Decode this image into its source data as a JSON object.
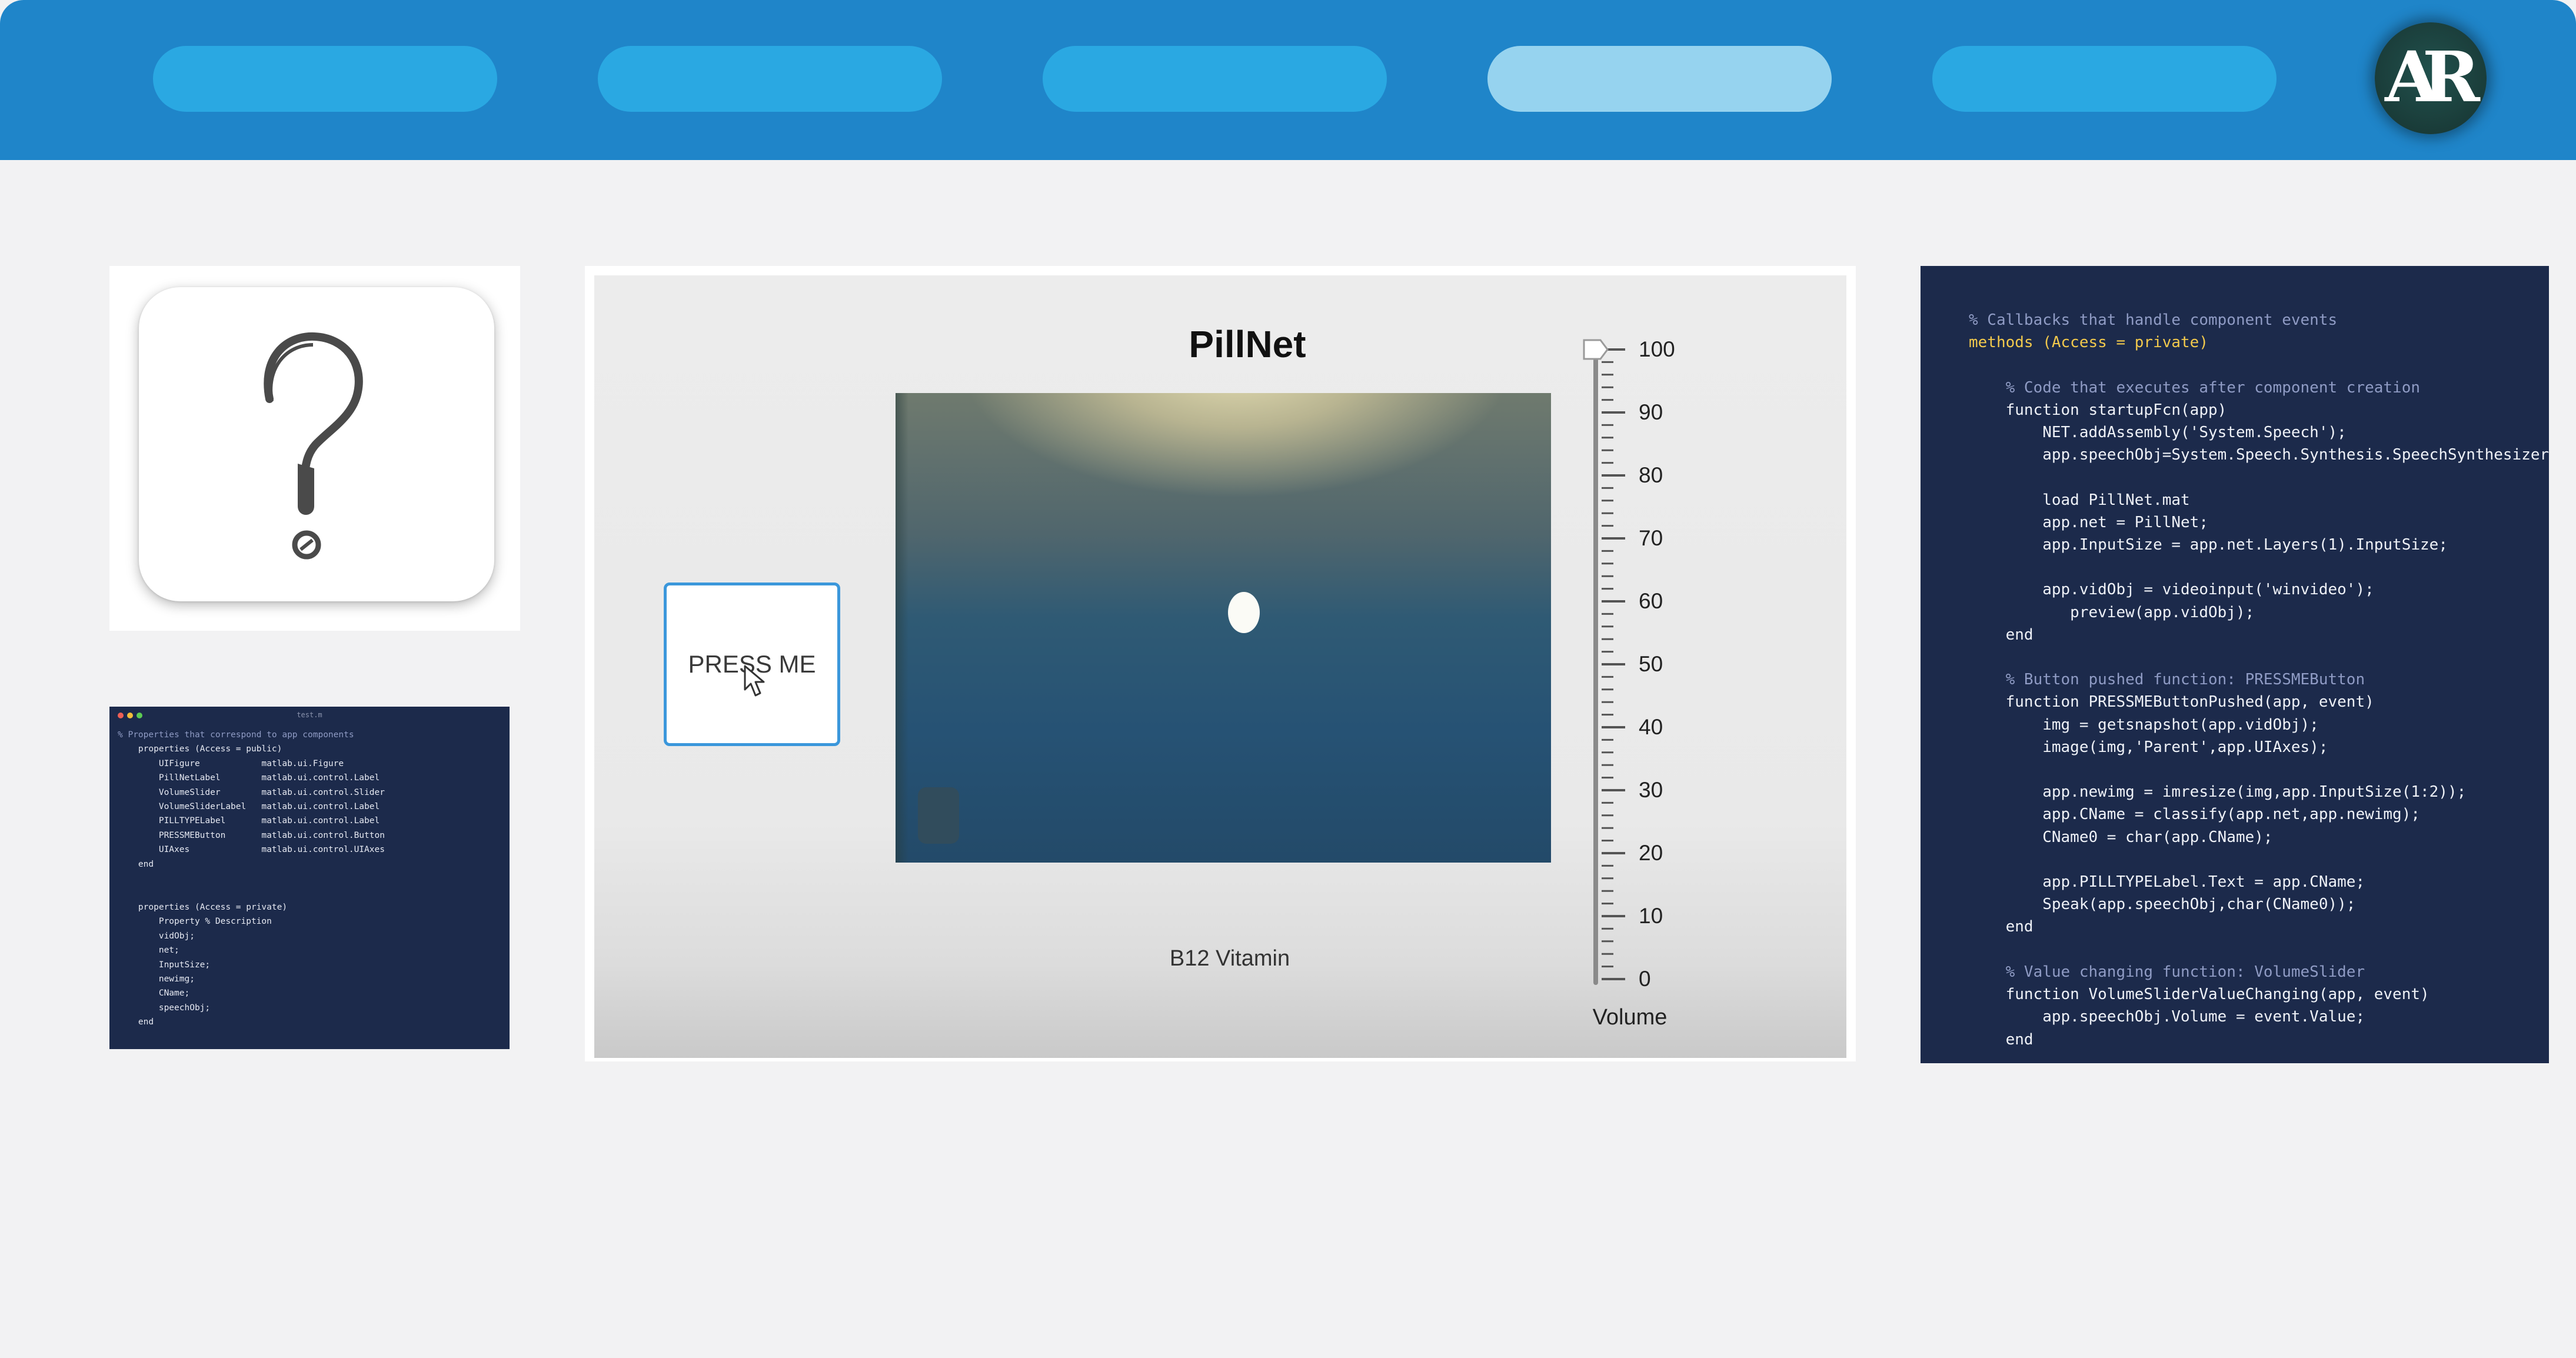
{
  "nav": {
    "items": [
      {
        "label": "",
        "active": false
      },
      {
        "label": "",
        "active": false
      },
      {
        "label": "",
        "active": false
      },
      {
        "label": "",
        "active": true
      },
      {
        "label": "",
        "active": false
      }
    ],
    "logo_text": "AR",
    "colors": {
      "bar": "#1f85c9",
      "pill": "#2aa8e2",
      "pill_active": "#96d3ef"
    }
  },
  "help_card": {
    "icon": "question-mark-icon"
  },
  "small_code": {
    "filename": "test.m",
    "lines": [
      "% Properties that correspond to app components",
      "    properties (Access = public)",
      "        UIFigure            matlab.ui.Figure",
      "        PillNetLabel        matlab.ui.control.Label",
      "        VolumeSlider        matlab.ui.control.Slider",
      "        VolumeSliderLabel   matlab.ui.control.Label",
      "        PILLTYPELabel       matlab.ui.control.Label",
      "        PRESSMEButton       matlab.ui.control.Button",
      "        UIAxes              matlab.ui.control.UIAxes",
      "    end",
      "",
      "",
      "    properties (Access = private)",
      "        Property % Description",
      "        vidObj;",
      "        net;",
      "        InputSize;",
      "        newimg;",
      "        CName;",
      "        speechObj;",
      "    end"
    ]
  },
  "app": {
    "title": "PillNet",
    "button_label": "PRESS ME",
    "result_label": "B12 Vitamin",
    "volume": {
      "label": "Volume",
      "value": 100,
      "range": [
        0,
        100
      ],
      "ticks": [
        "100",
        "90",
        "80",
        "70",
        "60",
        "50",
        "40",
        "30",
        "20",
        "10",
        "0"
      ]
    }
  },
  "big_code": {
    "lines": [
      "% Callbacks that handle component events",
      "methods (Access = private)",
      "",
      "    % Code that executes after component creation",
      "    function startupFcn(app)",
      "        NET.addAssembly('System.Speech');",
      "        app.speechObj=System.Speech.Synthesis.SpeechSynthesizer;",
      "",
      "        load PillNet.mat",
      "        app.net = PillNet;",
      "        app.InputSize = app.net.Layers(1).InputSize;",
      "",
      "        app.vidObj = videoinput('winvideo');",
      "           preview(app.vidObj);",
      "    end",
      "",
      "    % Button pushed function: PRESSMEButton",
      "    function PRESSMEButtonPushed(app, event)",
      "        img = getsnapshot(app.vidObj);",
      "        image(img,'Parent',app.UIAxes);",
      "",
      "        app.newimg = imresize(img,app.InputSize(1:2));",
      "        app.CName = classify(app.net,app.newimg);",
      "        CName0 = char(app.CName);",
      "",
      "        app.PILLTYPELabel.Text = app.CName;",
      "        Speak(app.speechObj,char(CName0));",
      "    end",
      "",
      "    % Value changing function: VolumeSlider",
      "    function VolumeSliderValueChanging(app, event)",
      "        app.speechObj.Volume = event.Value;",
      "    end"
    ]
  }
}
